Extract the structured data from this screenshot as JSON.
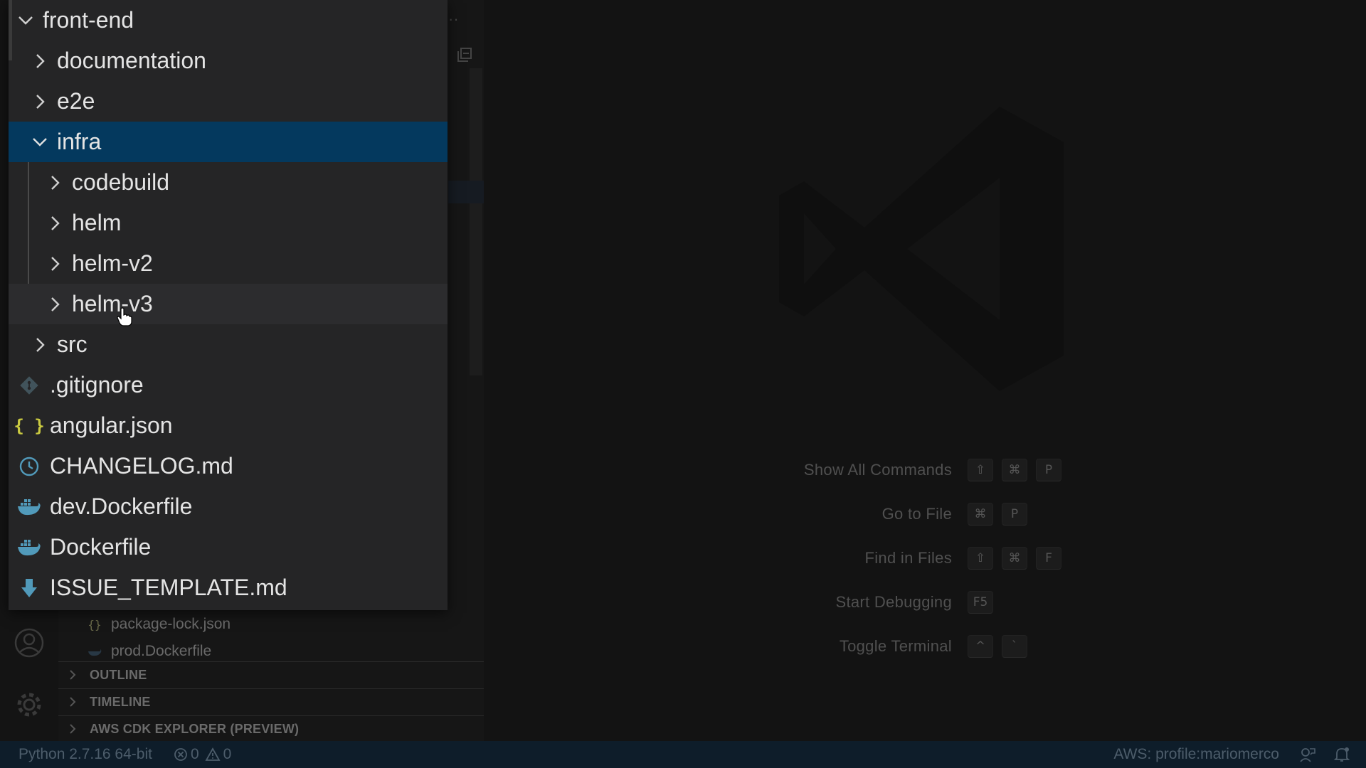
{
  "explorer": {
    "root": "front-end",
    "items": [
      {
        "label": "documentation",
        "kind": "folder"
      },
      {
        "label": "e2e",
        "kind": "folder"
      },
      {
        "label": "infra",
        "kind": "folder-open"
      },
      {
        "label": "codebuild",
        "kind": "folder"
      },
      {
        "label": "helm",
        "kind": "folder"
      },
      {
        "label": "helm-v2",
        "kind": "folder"
      },
      {
        "label": "helm-v3",
        "kind": "folder"
      },
      {
        "label": "src",
        "kind": "folder"
      },
      {
        "label": ".gitignore",
        "kind": "git-file"
      },
      {
        "label": "angular.json",
        "kind": "json-file"
      },
      {
        "label": "CHANGELOG.md",
        "kind": "changelog-file"
      },
      {
        "label": "dev.Dockerfile",
        "kind": "docker-file"
      },
      {
        "label": "Dockerfile",
        "kind": "docker-file"
      },
      {
        "label": "ISSUE_TEMPLATE.md",
        "kind": "markdown-file"
      }
    ],
    "background_files": [
      {
        "label": "package-lock.json",
        "icon": "json-icon"
      },
      {
        "label": "prod.Dockerfile",
        "icon": "docker-icon"
      }
    ]
  },
  "sections": {
    "outline": "OUTLINE",
    "timeline": "TIMELINE",
    "cdk": "AWS CDK EXPLORER (PREVIEW)"
  },
  "hints": [
    {
      "label": "Show All Commands",
      "keys": [
        "⇧",
        "⌘",
        "P"
      ]
    },
    {
      "label": "Go to File",
      "keys": [
        "⌘",
        "P"
      ]
    },
    {
      "label": "Find in Files",
      "keys": [
        "⇧",
        "⌘",
        "F"
      ]
    },
    {
      "label": "Start Debugging",
      "keys": [
        "F5"
      ]
    },
    {
      "label": "Toggle Terminal",
      "keys": [
        "^",
        "`"
      ]
    }
  ],
  "statusbar": {
    "python": "Python 2.7.16 64-bit",
    "errors": "0",
    "warnings": "0",
    "aws_profile": "AWS: profile:mariomerco"
  },
  "colors": {
    "selection": "#04395e",
    "folder_text": "#e4e4e4",
    "docker": "#2496ed",
    "json_brace": "#cbcb41",
    "statusbar_bg": "#0e1d2a"
  }
}
